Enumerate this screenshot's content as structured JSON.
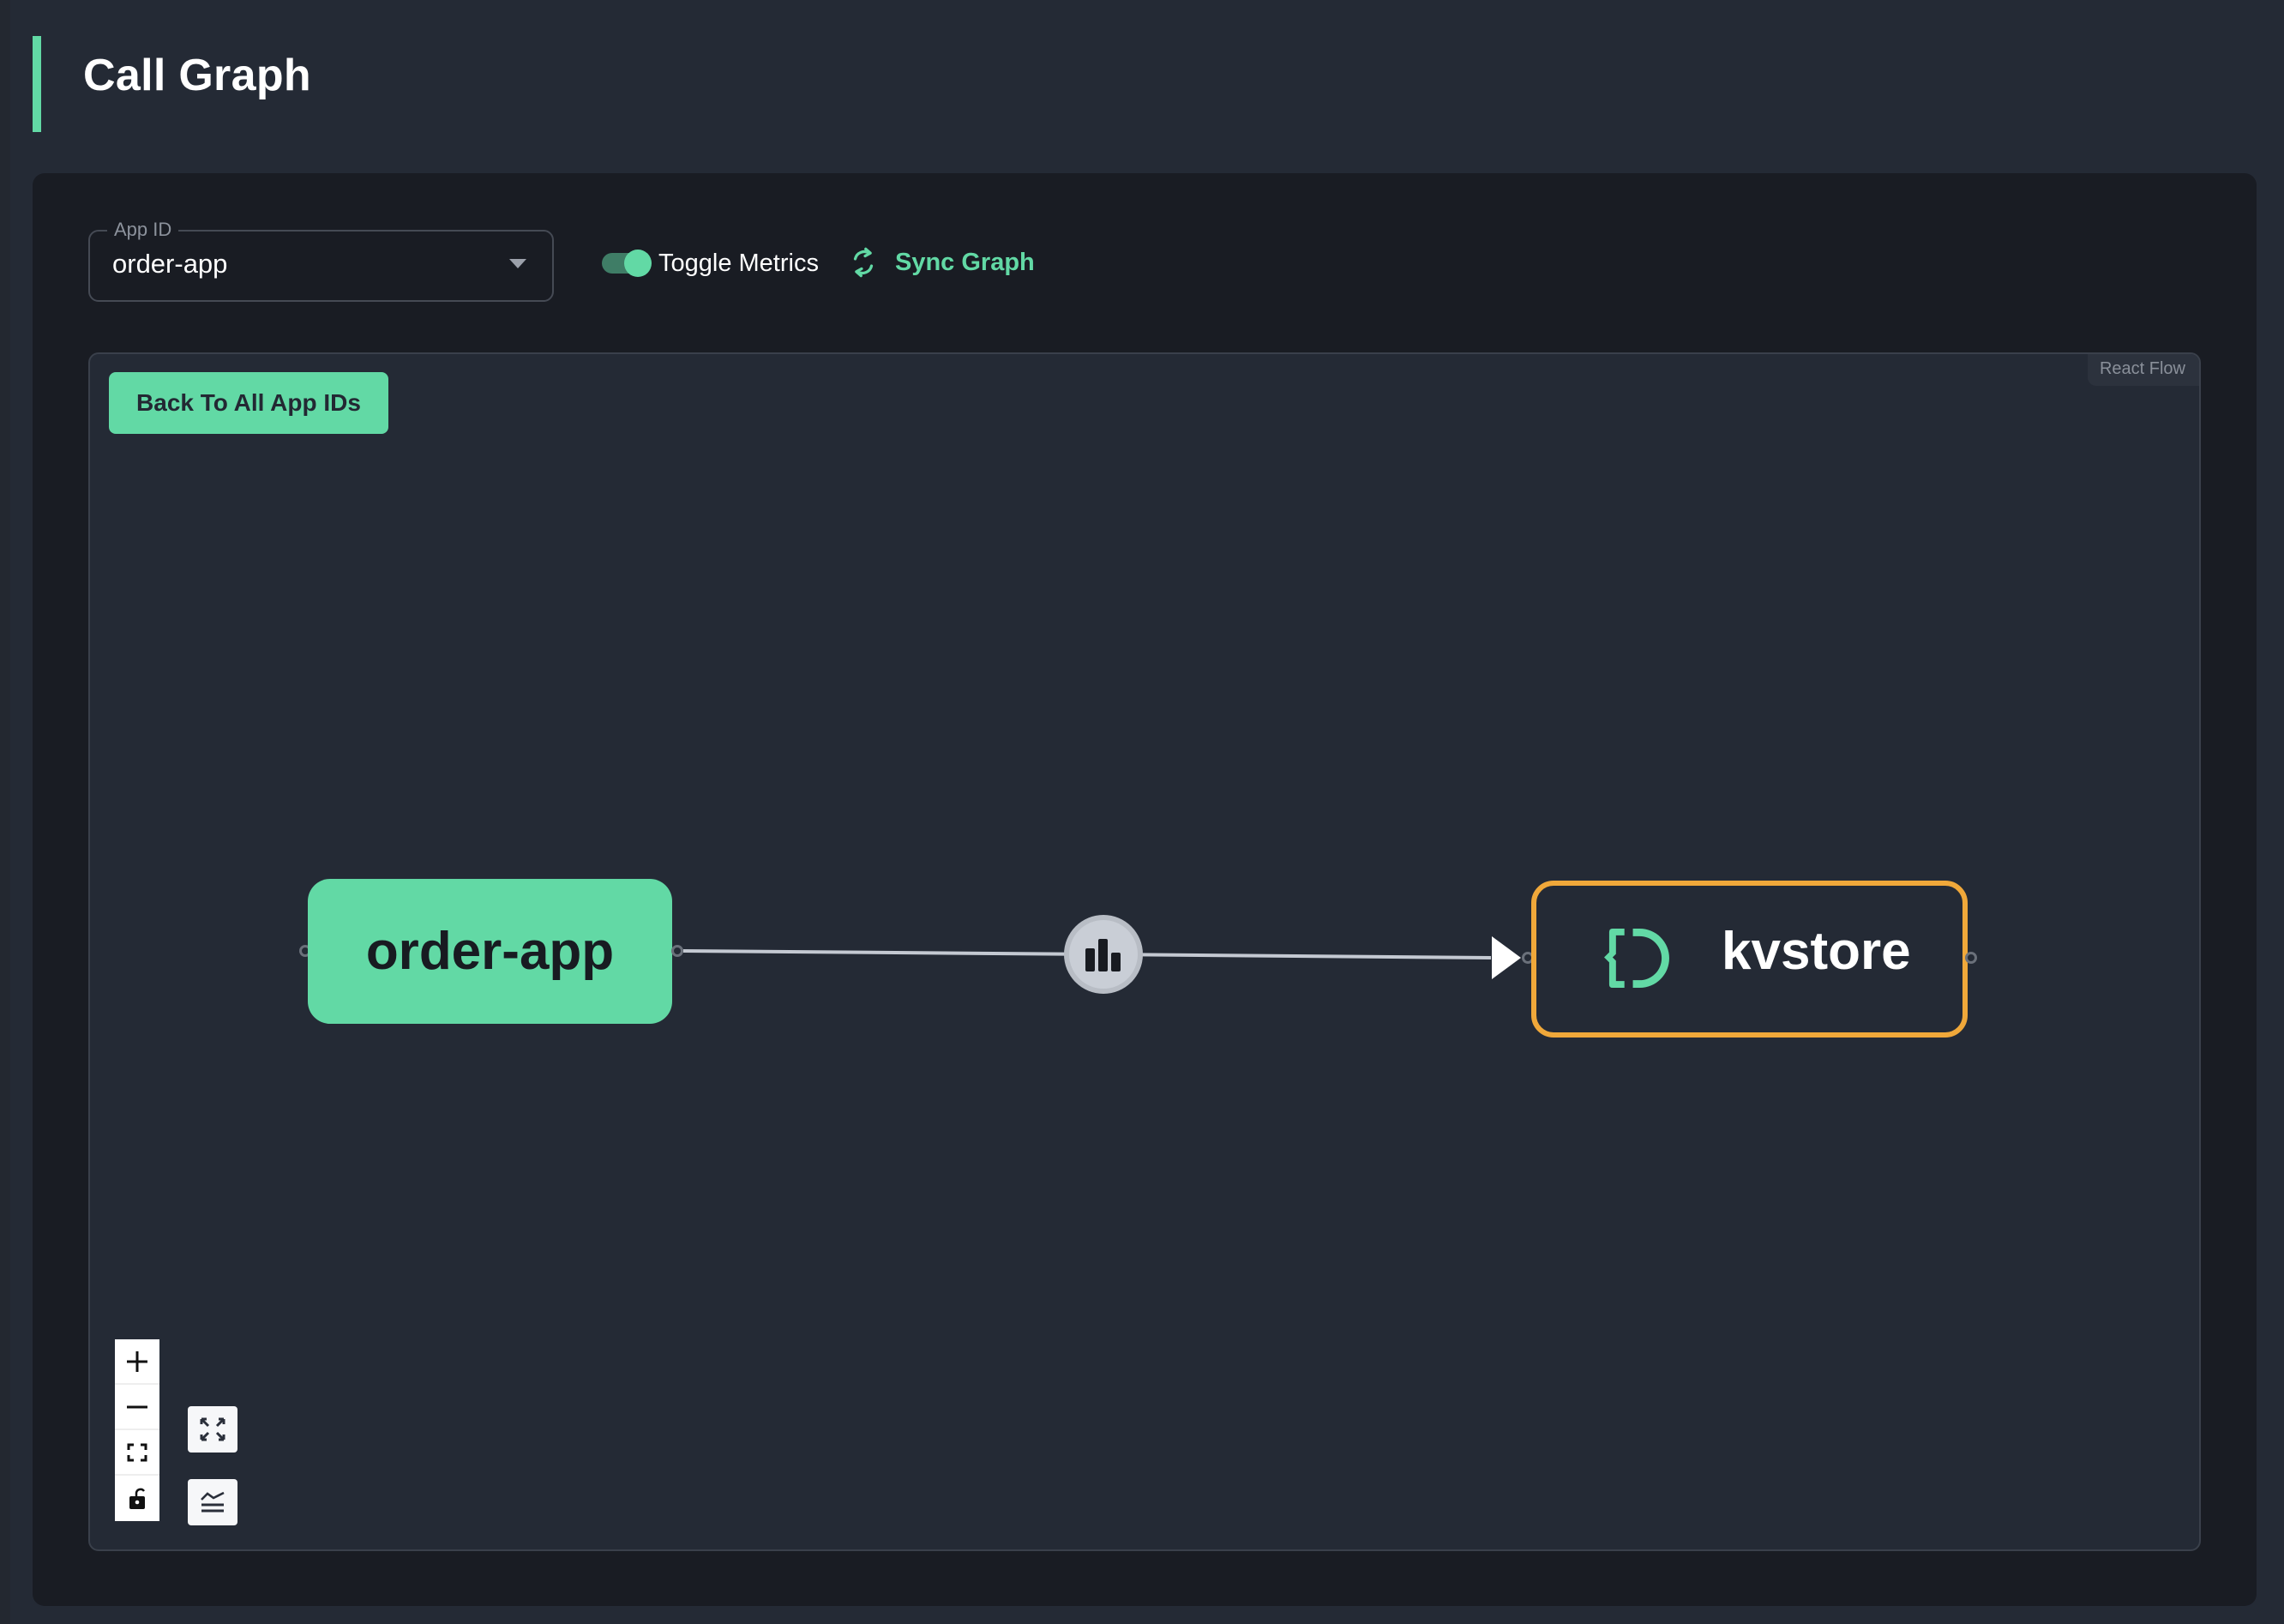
{
  "header": {
    "title": "Call Graph"
  },
  "toolbar": {
    "app_id_select": {
      "label": "App ID",
      "value": "order-app"
    },
    "toggle_metrics": {
      "label": "Toggle Metrics",
      "checked": true
    },
    "sync_button_label": "Sync Graph"
  },
  "flow": {
    "back_button_label": "Back To All App IDs",
    "attribution": "React Flow",
    "nodes": [
      {
        "id": "order-app",
        "label": "order-app",
        "type": "app"
      },
      {
        "id": "kvstore",
        "label": "kvstore",
        "type": "component",
        "icon": "dapr-component-icon"
      }
    ],
    "edges": [
      {
        "source": "order-app",
        "target": "kvstore",
        "badge_icon": "bar-chart-icon"
      }
    ],
    "controls": {
      "zoom_in": "plus-icon",
      "zoom_out": "minus-icon",
      "fit_view": "fit-view-icon",
      "lock": "unlock-icon",
      "fullscreen": "expand-icon",
      "minimap": "layout-icon"
    }
  },
  "colors": {
    "accent": "#62d9a5",
    "component_border": "#f0a83a",
    "background": "#242a35",
    "panel": "#191c23"
  }
}
